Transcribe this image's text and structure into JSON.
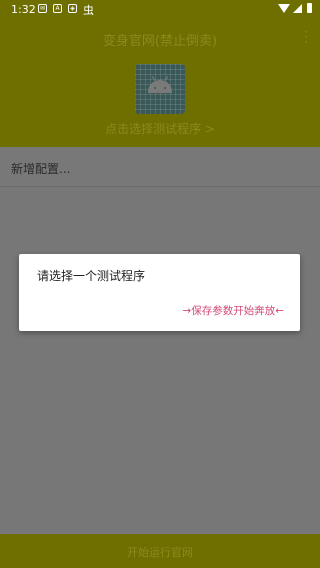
{
  "status_bar": {
    "time": "1:32",
    "notif_icons": [
      "mail-icon",
      "a-icon",
      "app-icon",
      "bug-icon"
    ]
  },
  "header": {
    "title": "变身官网(禁止倒卖)",
    "select_program_link": "点击选择测试程序 >"
  },
  "content": {
    "add_config_label": "新增配置..."
  },
  "bottom_bar": {
    "button_label": "开始运行官网"
  },
  "dialog": {
    "title": "请选择一个测试程序",
    "action_label": "→保存参数开始奔放←"
  },
  "colors": {
    "accent": "#d14b7a",
    "toolbar": "#6f6f00"
  }
}
